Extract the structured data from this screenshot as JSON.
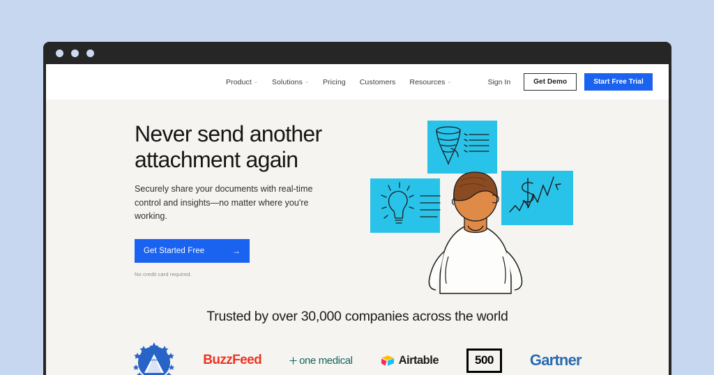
{
  "browser": {
    "dots": [
      "close-dot",
      "minimize-dot",
      "maximize-dot"
    ]
  },
  "nav": {
    "links": [
      {
        "label": "Product",
        "caret": "⌄"
      },
      {
        "label": "Solutions",
        "caret": "⌄"
      },
      {
        "label": "Pricing",
        "caret": ""
      },
      {
        "label": "Customers",
        "caret": ""
      },
      {
        "label": "Resources",
        "caret": "⌄"
      }
    ],
    "sign_in": "Sign In",
    "get_demo": "Get Demo",
    "start_trial": "Start Free Trial"
  },
  "hero": {
    "headline": "Never send another\nattachment again",
    "subhead": "Securely share your documents with real-time control and insights—no matter where you're working.",
    "cta_label": "Get Started Free",
    "cta_arrow": "→",
    "fineprint": "No credit card required.",
    "illustration": {
      "name": "person-viewing-dashboards",
      "panels": [
        "funnel-chart",
        "lightbulb-idea",
        "dollar-growth-chart"
      ],
      "panel_color": "#29c3ea",
      "hair_color": "#8a4a22",
      "skin_color": "#e08a47"
    }
  },
  "trust": {
    "title": "Trusted by over 30,000 companies across the world",
    "logos": [
      {
        "name": "paramount",
        "label": "Paramount",
        "color": "#2864c8"
      },
      {
        "name": "buzzfeed",
        "label": "BuzzFeed",
        "color": "#ee3322"
      },
      {
        "name": "one-medical",
        "label": "one medical",
        "color": "#15645c"
      },
      {
        "name": "airtable",
        "label": "Airtable",
        "color": "#1d1d1d"
      },
      {
        "name": "500",
        "label": "500",
        "color": "#000000"
      },
      {
        "name": "gartner",
        "label": "Gartner",
        "color": "#2a6ab0"
      }
    ]
  },
  "colors": {
    "page_background": "#c6d7ef",
    "chrome": "#262626",
    "hero_background": "#f5f4f1",
    "accent_blue": "#1a62f0",
    "panel_cyan": "#29c3ea"
  }
}
